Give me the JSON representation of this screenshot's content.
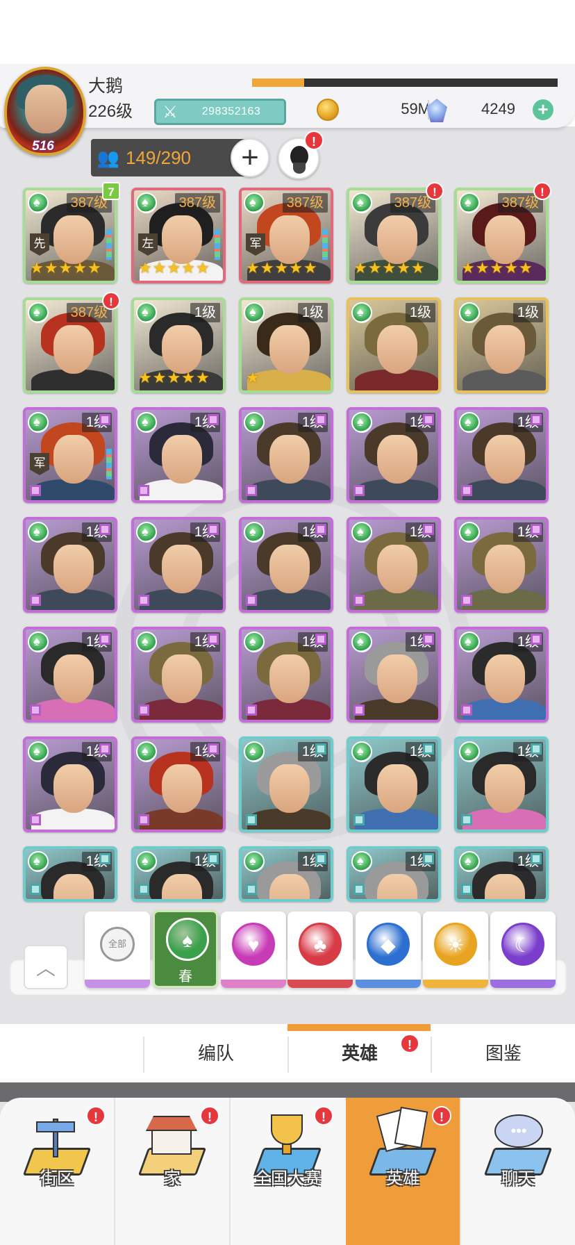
{
  "player": {
    "name": "大鹅",
    "level": "226级",
    "avatar_level": "516",
    "power": "298352163",
    "xp_progress": 0.17,
    "coins": "59M",
    "gems": "4249"
  },
  "capacity": {
    "value": "149/290"
  },
  "heroes": [
    {
      "level": "387级",
      "tier": "green",
      "stars": 5,
      "tag": "先",
      "badge": "7"
    },
    {
      "level": "387级",
      "tier": "red",
      "stars": 5,
      "tag": "左",
      "badge": ""
    },
    {
      "level": "387级",
      "tier": "red",
      "stars": 5,
      "tag": "军",
      "badge": ""
    },
    {
      "level": "387级",
      "tier": "green",
      "stars": 5,
      "tag": "",
      "badge": "!"
    },
    {
      "level": "387级",
      "tier": "green",
      "stars": 5,
      "tag": "",
      "badge": "!"
    },
    {
      "level": "387级",
      "tier": "green",
      "stars": 0,
      "tag": "",
      "badge": "!"
    },
    {
      "level": "1级",
      "tier": "green",
      "stars": 5,
      "tag": "",
      "badge": ""
    },
    {
      "level": "1级",
      "tier": "green",
      "stars": 1,
      "tag": "",
      "badge": ""
    },
    {
      "level": "1级",
      "tier": "gold",
      "stars": 0,
      "tag": "",
      "badge": ""
    },
    {
      "level": "1级",
      "tier": "gold",
      "stars": 0,
      "tag": "",
      "badge": ""
    },
    {
      "level": "1级",
      "tier": "purple",
      "stars": 0,
      "tag": "军",
      "badge": ""
    },
    {
      "level": "1级",
      "tier": "purple",
      "stars": 0,
      "tag": "",
      "badge": ""
    },
    {
      "level": "1级",
      "tier": "purple",
      "stars": 0,
      "tag": "",
      "badge": ""
    },
    {
      "level": "1级",
      "tier": "purple",
      "stars": 0,
      "tag": "",
      "badge": ""
    },
    {
      "level": "1级",
      "tier": "purple",
      "stars": 0,
      "tag": "",
      "badge": ""
    },
    {
      "level": "1级",
      "tier": "purple",
      "stars": 0,
      "tag": "",
      "badge": ""
    },
    {
      "level": "1级",
      "tier": "purple",
      "stars": 0,
      "tag": "",
      "badge": ""
    },
    {
      "level": "1级",
      "tier": "purple",
      "stars": 0,
      "tag": "",
      "badge": ""
    },
    {
      "level": "1级",
      "tier": "purple",
      "stars": 0,
      "tag": "",
      "badge": ""
    },
    {
      "level": "1级",
      "tier": "purple",
      "stars": 0,
      "tag": "",
      "badge": ""
    },
    {
      "level": "1级",
      "tier": "purple",
      "stars": 0,
      "tag": "",
      "badge": ""
    },
    {
      "level": "1级",
      "tier": "purple",
      "stars": 0,
      "tag": "",
      "badge": ""
    },
    {
      "level": "1级",
      "tier": "purple",
      "stars": 0,
      "tag": "",
      "badge": ""
    },
    {
      "level": "1级",
      "tier": "purple",
      "stars": 0,
      "tag": "",
      "badge": ""
    },
    {
      "level": "1级",
      "tier": "purple",
      "stars": 0,
      "tag": "",
      "badge": ""
    },
    {
      "level": "1级",
      "tier": "purple",
      "stars": 0,
      "tag": "",
      "badge": ""
    },
    {
      "level": "1级",
      "tier": "purple",
      "stars": 0,
      "tag": "",
      "badge": ""
    },
    {
      "level": "1级",
      "tier": "teal",
      "stars": 0,
      "tag": "",
      "badge": ""
    },
    {
      "level": "1级",
      "tier": "teal",
      "stars": 0,
      "tag": "",
      "badge": ""
    },
    {
      "level": "1级",
      "tier": "teal",
      "stars": 0,
      "tag": "",
      "badge": ""
    },
    {
      "level": "1级",
      "tier": "teal",
      "stars": 0,
      "tag": "",
      "badge": ""
    },
    {
      "level": "1级",
      "tier": "teal",
      "stars": 0,
      "tag": "",
      "badge": ""
    },
    {
      "level": "1级",
      "tier": "teal",
      "stars": 0,
      "tag": "",
      "badge": ""
    },
    {
      "level": "1级",
      "tier": "teal",
      "stars": 0,
      "tag": "",
      "badge": ""
    },
    {
      "level": "1级",
      "tier": "teal",
      "stars": 0,
      "tag": "",
      "badge": ""
    }
  ],
  "filters": [
    {
      "id": "all",
      "label": "全部",
      "color": "#ffffff",
      "strip": "#c88fe6"
    },
    {
      "id": "spring",
      "label": "春",
      "color": "#3aa04a",
      "strip": "#4b8b3f"
    },
    {
      "id": "heart",
      "label": "",
      "color": "#c83bb6",
      "strip": "#e080c8"
    },
    {
      "id": "club",
      "label": "",
      "color": "#d83a46",
      "strip": "#d94b53"
    },
    {
      "id": "diamond",
      "label": "",
      "color": "#2d6fd1",
      "strip": "#5a8fe0"
    },
    {
      "id": "sun",
      "label": "",
      "color": "#e8a420",
      "strip": "#f0b43c"
    },
    {
      "id": "moon",
      "label": "",
      "color": "#7b3ecc",
      "strip": "#9c6ee0"
    }
  ],
  "sub_tabs": {
    "formation": "编队",
    "heroes": "英雄",
    "gallery": "图鉴"
  },
  "nav": {
    "street": "街区",
    "home": "家",
    "tournament": "全国大赛",
    "heroes": "英雄",
    "chat": "聊天"
  },
  "colors": {
    "accent": "#ef9c3a",
    "badge": "#e6373c",
    "power": "#7dcbc3"
  }
}
